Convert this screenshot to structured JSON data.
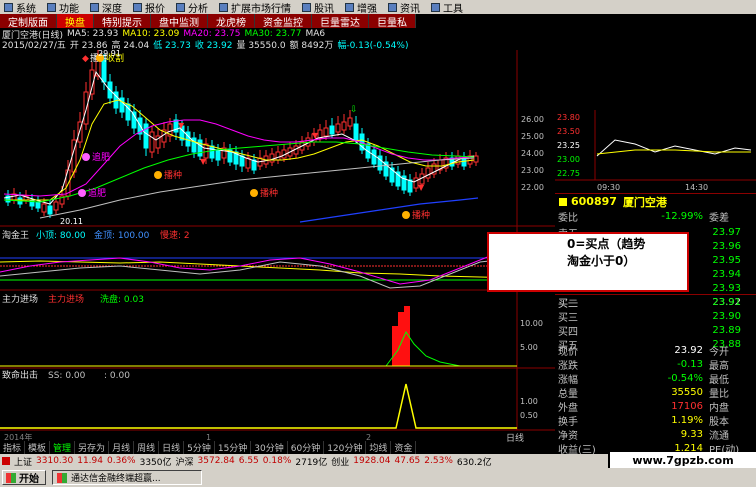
{
  "menu": [
    "系统",
    "功能",
    "报价",
    "分析",
    "扩展市场行情",
    "资讯",
    "工具"
  ],
  "menu_full": [
    "系统",
    "功能",
    "深度",
    "报价",
    "分析",
    "扩展市场行情",
    "股讯",
    "增强",
    "资讯",
    "工具"
  ],
  "tabs": [
    "定制版面",
    "换盘",
    "特别提示",
    "盘中监测",
    "龙虎榜",
    "资金监控",
    "巨量雷达",
    "巨量私"
  ],
  "active_tab": 1,
  "info": {
    "stock_name": "厦门空港(日线)",
    "ma5": "MA5: 23.93",
    "ma10": "MA10: 23.09",
    "ma20": "MA20: 23.75",
    "ma30": "MA30: 23.77",
    "ma60": "MA6",
    "date": "2015/02/27/五",
    "open": "开 23.86",
    "high": "高 24.04",
    "low": "低 23.73",
    "close": "收 23.92",
    "vol": "量 35550.0",
    "amount": "额 8492万",
    "change": "幅-0.13(-0.54%)"
  },
  "chart_labels": {
    "top_price": "29.91",
    "low_price": "20.11",
    "year": "2014年",
    "month_1": "1",
    "month_2": "2",
    "signal_buy": "播种",
    "signal_fat": "追肥",
    "signal_harvest": "收割"
  },
  "price_axis": [
    "26.00",
    "25.00",
    "24.00",
    "23.00",
    "22.00"
  ],
  "indicator1": {
    "name": "淘金王",
    "p1": "小顶: 80.00",
    "p2": "金顶: 100.00",
    "p3": "慢速: 2"
  },
  "indicator2": {
    "name": "主力进场",
    "p1": "主力进场",
    "p2": "洗盘: 0.03",
    "axis": [
      "10.00",
      "5.00"
    ]
  },
  "indicator3": {
    "name": "致命出击",
    "p1": "SS: 0.00",
    "p2": ": 0.00",
    "axis": [
      "1.00",
      "0.50"
    ]
  },
  "mini_chart": {
    "prices": [
      "23.80",
      "23.50",
      "23.25",
      "23.00",
      "22.75"
    ],
    "labels": [
      "09:30",
      "14:30"
    ],
    "times": []
  },
  "quote_header": {
    "code": "600897",
    "name": "厦门空港"
  },
  "quote": {
    "weibi_label": "委比",
    "weibi": "-12.99%",
    "weicha_label": "委差",
    "sell5": "23.97",
    "sell4": "23.96",
    "sell3": "23.95",
    "sell2": "23.94",
    "sell1": "23.93",
    "sell_label": "卖五",
    "buy1_label": "买一",
    "buy1": "23.92",
    "buy2_label": "买二",
    "buy2": "23.91",
    "buy3_label": "买三",
    "buy3": "23.90",
    "buy4_label": "买四",
    "buy4": "23.89",
    "buy5_label": "买五",
    "buy5": "23.88"
  },
  "stats": [
    {
      "l": "现价",
      "v": "23.92",
      "r": "今开",
      "vc": "#ffffff"
    },
    {
      "l": "涨跌",
      "v": "-0.13",
      "r": "最高",
      "vc": "#00ff00"
    },
    {
      "l": "涨幅",
      "v": "-0.54%",
      "r": "最低",
      "vc": "#00ff00"
    },
    {
      "l": "总量",
      "v": "35550",
      "r": "量比",
      "vc": "#ffff00"
    },
    {
      "l": "外盘",
      "v": "17106",
      "r": "内盘",
      "vc": "#ff3030"
    },
    {
      "l": "换手",
      "v": "1.19%",
      "r": "股本",
      "vc": "#ffff00"
    },
    {
      "l": "净资",
      "v": "9.33",
      "r": "流通",
      "vc": "#ffff00"
    },
    {
      "l": "收益(三)",
      "v": "1.214",
      "r": "PE(动)",
      "vc": "#ffff00"
    }
  ],
  "overlay": {
    "line1": "0=买点（趋势",
    "line2": "淘金小于0）"
  },
  "bottom_tabs": [
    "指标",
    "模板",
    "管理",
    "另存为",
    "月线",
    "周线",
    "日线",
    "5分钟",
    "15分钟",
    "30分钟",
    "60分钟",
    "120分钟",
    "均线",
    "资金"
  ],
  "bottom_active": 2,
  "daily_label": "日线",
  "statusbar": {
    "sh_label": "上证",
    "sh_val": "3310.30",
    "sh_chg": "11.94",
    "sh_pct": "0.36%",
    "sh_amt": "3350亿",
    "sz_label": "沪深",
    "sz_val": "3572.84",
    "sz_chg": "6.55",
    "sz_pct": "0.18%",
    "sz_amt": "2719亿",
    "cy_label": "创业",
    "cy_val": "1928.04",
    "cy_chg": "47.65",
    "cy_pct": "2.53%",
    "cy_amt": "630.2亿"
  },
  "taskbar": {
    "start": "开始",
    "item": "通达信金融终端超赢..."
  },
  "watermark": "www.7gpzb.com",
  "colors": {
    "up": "#ff3030",
    "down": "#00ffff",
    "bg": "#000000",
    "accent_red": "#c00000"
  }
}
